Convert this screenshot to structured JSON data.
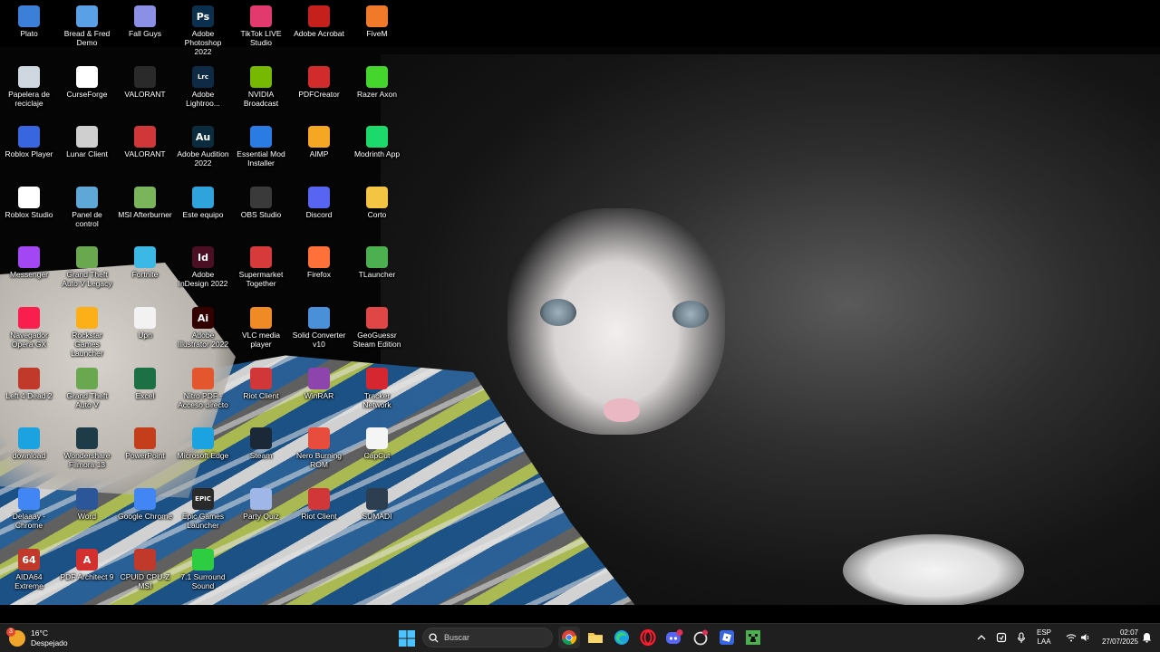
{
  "desktop": {
    "icons": [
      {
        "label": "Plato",
        "icon": "app-icon",
        "color": "#3b7fd9"
      },
      {
        "label": "Bread & Fred Demo",
        "icon": "game-icon",
        "color": "#5aa0e6"
      },
      {
        "label": "Fall Guys",
        "icon": "game-icon",
        "color": "#8b8fe6"
      },
      {
        "label": "Adobe Photoshop 2022",
        "icon": "photoshop-icon",
        "color": "#0c2f4e",
        "glyph": "Ps"
      },
      {
        "label": "TikTok LIVE Studio",
        "icon": "tiktok-icon",
        "color": "#e23a6e"
      },
      {
        "label": "Adobe Acrobat",
        "icon": "acrobat-icon",
        "color": "#c5201b"
      },
      {
        "label": "FiveM",
        "icon": "fivem-icon",
        "color": "#f07a2a"
      },
      {
        "label": "Papelera de reciclaje",
        "icon": "recycle-bin-icon",
        "color": "#cfd8e0"
      },
      {
        "label": "CurseForge",
        "icon": "curseforge-icon",
        "color": "#ffffff"
      },
      {
        "label": "VALORANT",
        "icon": "valorant-icon",
        "color": "#2a2a2a"
      },
      {
        "label": "Adobe Lightroo...",
        "icon": "lightroom-icon",
        "color": "#0f2a45",
        "glyph": "Lrc"
      },
      {
        "label": "NVIDIA Broadcast",
        "icon": "nvidia-icon",
        "color": "#76b900"
      },
      {
        "label": "PDFCreator",
        "icon": "pdfcreator-icon",
        "color": "#d22b2b"
      },
      {
        "label": "Razer Axon",
        "icon": "razer-icon",
        "color": "#44d62c"
      },
      {
        "label": "Roblox Player",
        "icon": "roblox-icon",
        "color": "#3866e0"
      },
      {
        "label": "Lunar Client",
        "icon": "lunar-icon",
        "color": "#cfcfcf"
      },
      {
        "label": "VALORANT",
        "icon": "riot-icon",
        "color": "#d13639"
      },
      {
        "label": "Adobe Audition 2022",
        "icon": "audition-icon",
        "color": "#0b2c3e",
        "glyph": "Au"
      },
      {
        "label": "Essential Mod Installer",
        "icon": "essential-icon",
        "color": "#2b7be4"
      },
      {
        "label": "AIMP",
        "icon": "aimp-icon",
        "color": "#f5a623"
      },
      {
        "label": "Modrinth App",
        "icon": "modrinth-icon",
        "color": "#1bd96a"
      },
      {
        "label": "Roblox Studio",
        "icon": "roblox-studio-icon",
        "color": "#ffffff"
      },
      {
        "label": "Panel de control",
        "icon": "control-panel-icon",
        "color": "#5fa7d6"
      },
      {
        "label": "MSI Afterburner",
        "icon": "afterburner-icon",
        "color": "#7ab55c"
      },
      {
        "label": "Este equipo",
        "icon": "this-pc-icon",
        "color": "#2fa3dc"
      },
      {
        "label": "OBS Studio",
        "icon": "obs-icon",
        "color": "#3a3a3a"
      },
      {
        "label": "Discord",
        "icon": "discord-icon",
        "color": "#5865f2"
      },
      {
        "label": "Corto",
        "icon": "folder-icon",
        "color": "#f4c542"
      },
      {
        "label": "Messenger",
        "icon": "messenger-icon",
        "color": "#a347f5"
      },
      {
        "label": "Grand Theft Auto V Legacy",
        "icon": "gta-icon",
        "color": "#6aa84f"
      },
      {
        "label": "Fortnite",
        "icon": "fortnite-icon",
        "color": "#3bb8e6"
      },
      {
        "label": "Adobe InDesign 2022",
        "icon": "indesign-icon",
        "color": "#4a0f23",
        "glyph": "Id"
      },
      {
        "label": "Supermarket Together",
        "icon": "supermarket-icon",
        "color": "#d63a3a"
      },
      {
        "label": "Firefox",
        "icon": "firefox-icon",
        "color": "#ff7139"
      },
      {
        "label": "TLauncher",
        "icon": "tlauncher-icon",
        "color": "#4caf50"
      },
      {
        "label": "Navegador Opera GX",
        "icon": "opera-gx-icon",
        "color": "#fa1e4e"
      },
      {
        "label": "Rockstar Games Launcher",
        "icon": "rockstar-icon",
        "color": "#fcaf17"
      },
      {
        "label": "Upn",
        "icon": "file-icon",
        "color": "#f2f2f2"
      },
      {
        "label": "Adobe Illustrator 2022",
        "icon": "illustrator-icon",
        "color": "#330000",
        "glyph": "Ai"
      },
      {
        "label": "VLC media player",
        "icon": "vlc-icon",
        "color": "#f08a24"
      },
      {
        "label": "Solid Converter v10",
        "icon": "solid-converter-icon",
        "color": "#4a90d9"
      },
      {
        "label": "GeoGuessr Steam Edition",
        "icon": "geoguessr-icon",
        "color": "#e04646"
      },
      {
        "label": "Left 4 Dead 2",
        "icon": "l4d2-icon",
        "color": "#c0392b"
      },
      {
        "label": "Grand Theft Auto V",
        "icon": "gta-icon",
        "color": "#6aa84f"
      },
      {
        "label": "Excel",
        "icon": "excel-icon",
        "color": "#1d7044"
      },
      {
        "label": "Nitro PDF - Acceso directo",
        "icon": "nitro-pdf-icon",
        "color": "#e4572e"
      },
      {
        "label": "Riot Client",
        "icon": "riot-icon",
        "color": "#d13639"
      },
      {
        "label": "WinRAR",
        "icon": "winrar-icon",
        "color": "#8e44ad"
      },
      {
        "label": "Tracker Network",
        "icon": "tracker-network-icon",
        "color": "#d6262f"
      },
      {
        "label": "download",
        "icon": "edge-icon",
        "color": "#1aa3e0"
      },
      {
        "label": "Wondershare Filmora 13",
        "icon": "filmora-icon",
        "color": "#1e3c48"
      },
      {
        "label": "PowerPoint",
        "icon": "powerpoint-icon",
        "color": "#c43e1c"
      },
      {
        "label": "Microsoft Edge",
        "icon": "edge-icon",
        "color": "#1aa3e0"
      },
      {
        "label": "Steam",
        "icon": "steam-icon",
        "color": "#1b2838"
      },
      {
        "label": "Nero Burning ROM",
        "icon": "nero-icon",
        "color": "#e74c3c"
      },
      {
        "label": "CapCut",
        "icon": "capcut-icon",
        "color": "#f5f5f5"
      },
      {
        "label": "Delaaay - Chrome",
        "icon": "chrome-icon",
        "color": "#4285f4"
      },
      {
        "label": "Word",
        "icon": "word-icon",
        "color": "#2b579a"
      },
      {
        "label": "Google Chrome",
        "icon": "chrome-icon",
        "color": "#4285f4"
      },
      {
        "label": "Epic Games Launcher",
        "icon": "epic-games-icon",
        "color": "#2a2a2a",
        "glyph": "EPIC"
      },
      {
        "label": "Party Quiz",
        "icon": "party-quiz-icon",
        "color": "#9fb7e8"
      },
      {
        "label": "Riot Client",
        "icon": "riot-icon",
        "color": "#d13639"
      },
      {
        "label": "SUMADI",
        "icon": "sumadi-icon",
        "color": "#2c3e50"
      },
      {
        "label": "AIDA64 Extreme",
        "icon": "aida64-icon",
        "color": "#c0392b",
        "glyph": "64"
      },
      {
        "label": "PDF Architect 9",
        "icon": "pdf-architect-icon",
        "color": "#d32f2f",
        "glyph": "A"
      },
      {
        "label": "CPUID CPU-Z MSI",
        "icon": "cpuz-icon",
        "color": "#c0392b"
      },
      {
        "label": "7.1 Surround Sound",
        "icon": "surround-sound-icon",
        "color": "#2ecc40"
      }
    ]
  },
  "taskbar": {
    "weather": {
      "temp": "16°C",
      "condition": "Despejado",
      "badge": "3"
    },
    "search_placeholder": "Buscar",
    "pinned": [
      {
        "name": "chrome",
        "icon": "chrome-icon"
      },
      {
        "name": "file-explorer",
        "icon": "folder-icon"
      },
      {
        "name": "edge",
        "icon": "edge-icon"
      },
      {
        "name": "opera",
        "icon": "opera-icon"
      },
      {
        "name": "discord",
        "icon": "discord-icon",
        "badge": "99+"
      },
      {
        "name": "steam-like",
        "icon": "app-icon"
      },
      {
        "name": "roblox",
        "icon": "roblox-icon"
      },
      {
        "name": "minecraft",
        "icon": "minecraft-icon"
      }
    ],
    "tray": {
      "language": "ESP",
      "layout": "LAA",
      "time": "02:07",
      "date": "27/07/2025"
    }
  }
}
